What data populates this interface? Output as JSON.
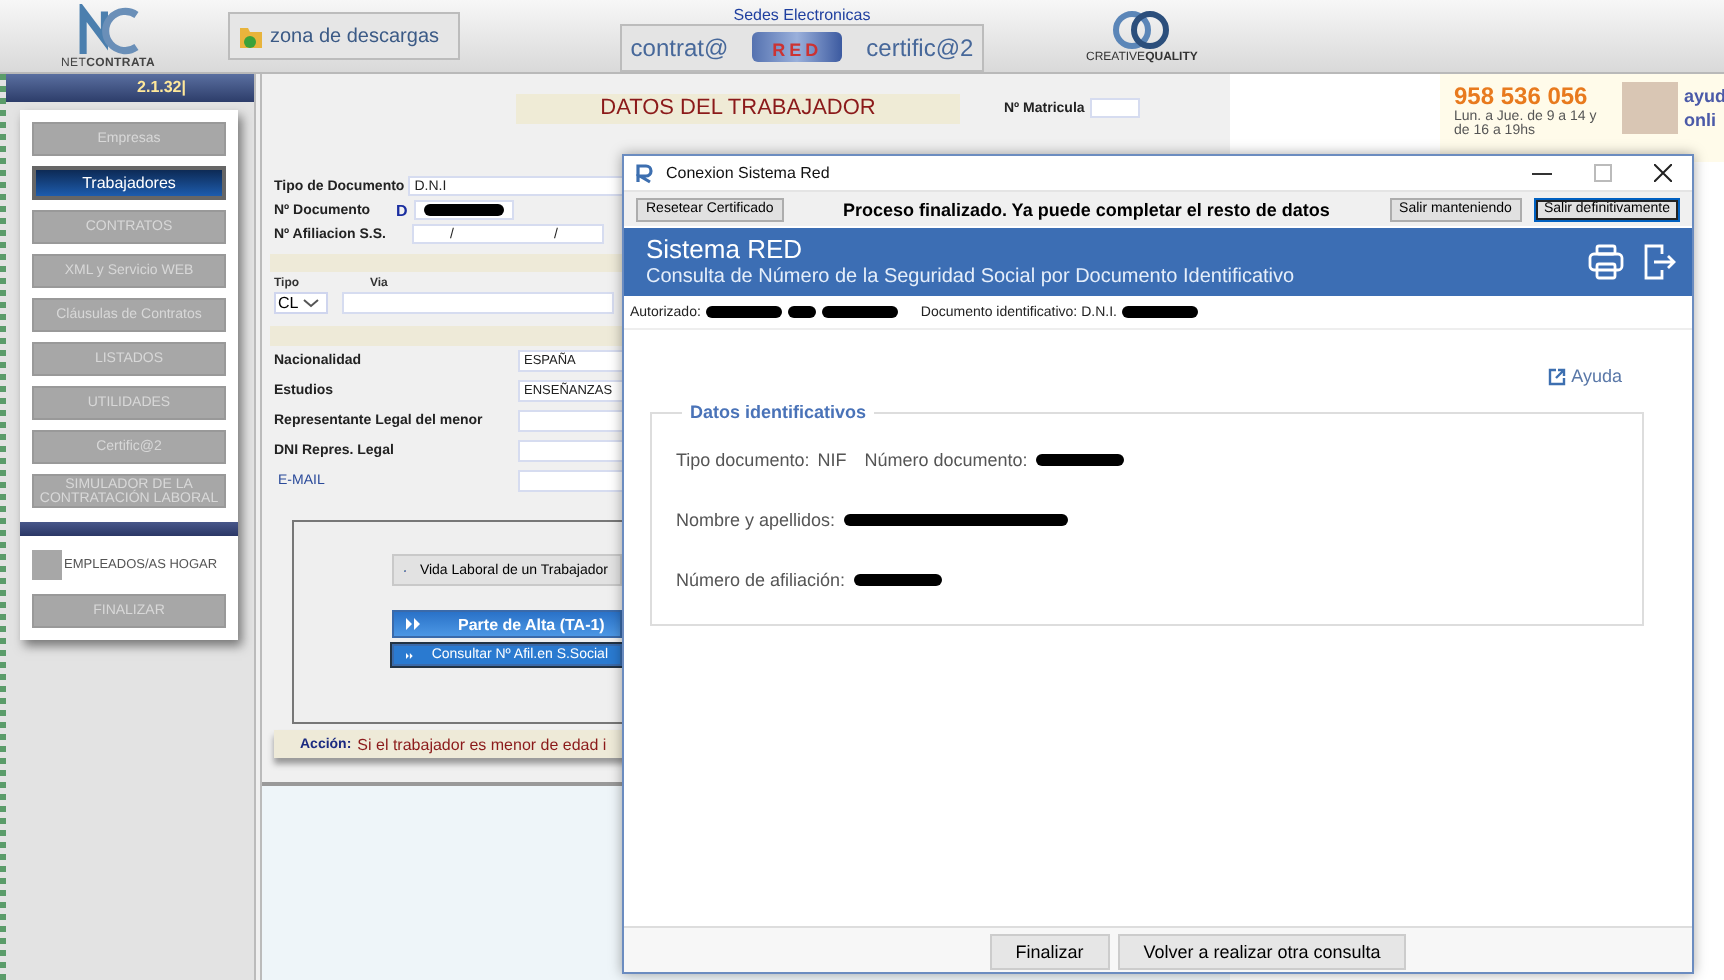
{
  "header": {
    "brand": "NET**CONTRATA**",
    "downloads": "zona de descargas",
    "sedes_title": "Sedes Electronicas",
    "sedes": [
      {
        "label": "contrat@",
        "kind": "text"
      },
      {
        "label": "RED",
        "kind": "logo"
      },
      {
        "label": "certific@2",
        "kind": "text"
      }
    ],
    "partner": "CREATIVE**QUALITY**"
  },
  "version": "2.1.32|",
  "sidebar": {
    "items": [
      {
        "label": "Empresas",
        "selected": false,
        "disabled": true
      },
      {
        "label": "Trabajadores",
        "selected": true,
        "disabled": false
      },
      {
        "label": "CONTRATOS",
        "selected": false,
        "disabled": true
      },
      {
        "label": "XML y Servicio WEB",
        "selected": false,
        "disabled": true
      },
      {
        "label": "Cláusulas de Contratos",
        "selected": false,
        "disabled": true
      },
      {
        "label": "LISTADOS",
        "selected": false,
        "disabled": true
      },
      {
        "label": "UTILIDADES",
        "selected": false,
        "disabled": true
      },
      {
        "label": "Certific@2",
        "selected": false,
        "disabled": true
      },
      {
        "label": "SIMULADOR DE LA CONTRATACIÓN LABORAL",
        "selected": false,
        "disabled": true
      }
    ],
    "hogar": {
      "label": "EMPLEADOS/AS HOGAR",
      "checked": false
    },
    "exit": "FINALIZAR"
  },
  "form": {
    "title": "DATOS DEL TRABAJADOR",
    "matricula_label": "Nº Matricula",
    "tipo_documento": {
      "label": "Tipo de Documento",
      "value": "D.N.I"
    },
    "numero_documento": {
      "label": "Nº Documento",
      "prefix": "D"
    },
    "afiliacion": {
      "label": "Nº Afiliacion S.S.",
      "parts": [
        "/",
        "/"
      ]
    },
    "address": {
      "tipo_label": "Tipo",
      "via_label": "Via",
      "tipo_value": "CL"
    },
    "fields": [
      {
        "label": "Nacionalidad",
        "value": "ESPAÑA",
        "kind": "plain"
      },
      {
        "label": "Estudios",
        "value": "ENSEÑANZAS",
        "kind": "plain"
      },
      {
        "label": "Representante Legal del menor",
        "kind": "plain"
      },
      {
        "label": "DNI Repres. Legal",
        "kind": "plain"
      },
      {
        "label": "E-MAIL",
        "kind": "link"
      }
    ],
    "actions": [
      {
        "label": "Vida Laboral de un Trabajador",
        "kind": "grey"
      },
      {
        "label": "Parte de Alta  (TA-1)",
        "kind": "primary"
      },
      {
        "label": "Consultar Nº Afil.en S.Social",
        "kind": "secondary"
      }
    ],
    "accion_label": "Acción:",
    "accion_text": "Si el trabajador es menor de edad i"
  },
  "ad": {
    "phone": "958 536 056",
    "hours": [
      "Lun. a Jue. de 9 a 14 y",
      "de 16 a 19hs"
    ],
    "side": [
      "ayud",
      "onli"
    ]
  },
  "dialog": {
    "title": "Conexion Sistema Red",
    "reset": "Resetear Certificado",
    "message": "Proceso finalizado. Ya puede completar el resto de datos",
    "exits": [
      {
        "label": "Salir manteniendo",
        "selected": false
      },
      {
        "label": "Salir definitivamente",
        "selected": true
      }
    ],
    "band_title": "Sistema RED",
    "band_subtitle": "Consulta de Número de la Seguridad Social por Documento Identificativo",
    "authorized_label": "Autorizado:",
    "document_label": "Documento identificativo: D.N.I.",
    "help": "Ayuda",
    "legend": "Datos identificativos",
    "rows": [
      [
        {
          "label": "Tipo documento:",
          "value": "NIF"
        },
        {
          "label": "Número documento:",
          "redacted": true
        }
      ],
      [
        {
          "label": "Nombre y apellidos:",
          "redacted": true
        }
      ],
      [
        {
          "label": "Número de afiliación:",
          "redacted": true
        }
      ]
    ],
    "footer": [
      "Finalizar",
      "Volver a realizar otra consulta"
    ]
  }
}
